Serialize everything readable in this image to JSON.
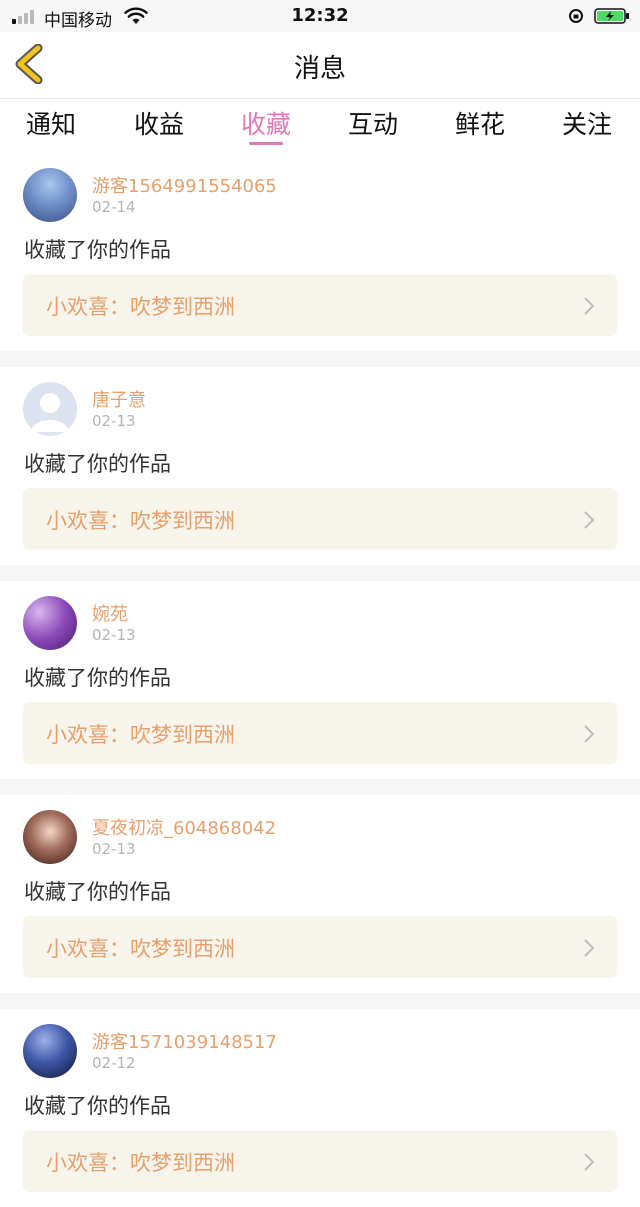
{
  "status_bar": {
    "carrier": "中国移动",
    "time": "12:32"
  },
  "nav": {
    "title": "消息"
  },
  "tabs": [
    {
      "label": "通知",
      "active": false
    },
    {
      "label": "收益",
      "active": false
    },
    {
      "label": "收藏",
      "active": true
    },
    {
      "label": "互动",
      "active": false
    },
    {
      "label": "鲜花",
      "active": false
    },
    {
      "label": "关注",
      "active": false
    }
  ],
  "items": [
    {
      "username": "游客1564991554065",
      "date": "02-14",
      "action": "收藏了你的作品",
      "work": "小欢喜：吹梦到西洲"
    },
    {
      "username": "唐子意",
      "date": "02-13",
      "action": "收藏了你的作品",
      "work": "小欢喜：吹梦到西洲"
    },
    {
      "username": "婉苑",
      "date": "02-13",
      "action": "收藏了你的作品",
      "work": "小欢喜：吹梦到西洲"
    },
    {
      "username": "夏夜初凉_604868042",
      "date": "02-13",
      "action": "收藏了你的作品",
      "work": "小欢喜：吹梦到西洲"
    },
    {
      "username": "游客1571039148517",
      "date": "02-12",
      "action": "收藏了你的作品",
      "work": "小欢喜：吹梦到西洲"
    }
  ],
  "colors": {
    "accent_pink": "#e07ab7",
    "name_orange": "#e7a06c",
    "back_yellow": "#f0c419",
    "work_box_bg": "#f6f4eb"
  }
}
